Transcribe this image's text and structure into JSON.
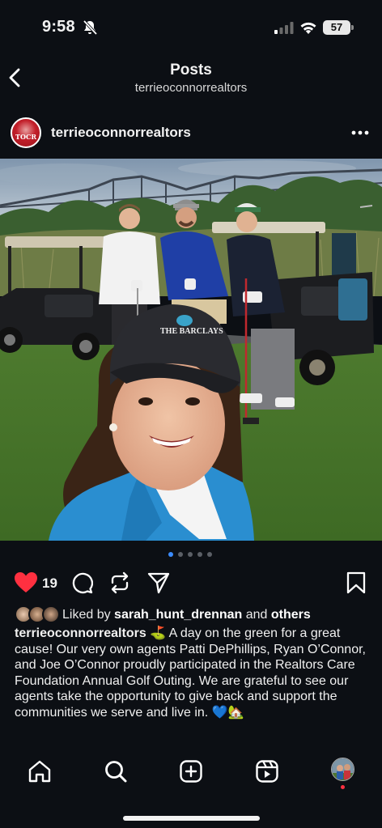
{
  "status_bar": {
    "time": "9:58",
    "battery": "57"
  },
  "header": {
    "title": "Posts",
    "subtitle": "terrieoconnorrealtors"
  },
  "post": {
    "username": "terrieoconnorrealtors",
    "avatar_text": "TOCR",
    "cap_logo_text": "THE BARCLAYS",
    "carousel": {
      "count": 5,
      "active_index": 0
    },
    "likes": "19",
    "liked_by_prefix": "Liked by ",
    "liked_by_user": "sarah_hunt_drennan",
    "liked_by_and": " and ",
    "liked_by_others": "others",
    "caption_user": "terrieoconnorrealtors",
    "caption_text": "⛳ A day on the green for a great cause! Our very own agents Patti DePhillips, Ryan O’Connor, and Joe O’Connor proudly participated in the Realtors Care Foundation Annual Golf Outing. We are grateful to see our agents take the opportunity to give back and support the communities we serve and live in. 💙🏡"
  },
  "colors": {
    "background": "#0c0f14",
    "like_red": "#ff3040",
    "accent_blue": "#3b8cff"
  },
  "icons": [
    "bell-slash-icon",
    "signal-icon",
    "wifi-icon",
    "back-chevron-icon",
    "more-icon",
    "heart-icon",
    "comment-icon",
    "repost-icon",
    "share-icon",
    "bookmark-icon",
    "home-icon",
    "search-icon",
    "create-icon",
    "reels-icon"
  ]
}
